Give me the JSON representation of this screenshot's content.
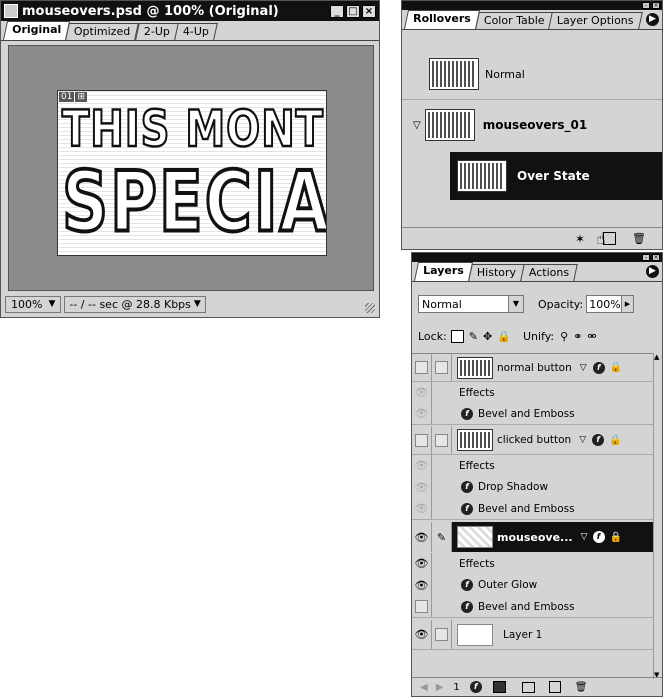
{
  "doc_window": {
    "title": "mouseovers.psd @ 100% (Original)",
    "tabs": [
      "Original",
      "Optimized",
      "2-Up",
      "4-Up"
    ],
    "canvas_text_line1": "THIS MONTH'S",
    "canvas_text_line2": "SPECIAL",
    "slice_badge": "01",
    "zoom": "100%",
    "download_info": "-- / -- sec @ 28.8 Kbps"
  },
  "rollovers_panel": {
    "tabs": [
      "Rollovers",
      "Color Table",
      "Layer Options"
    ],
    "items": [
      {
        "label": "Normal"
      },
      {
        "label": "mouseovers_01"
      },
      {
        "label": "Over State"
      }
    ]
  },
  "layers_panel": {
    "tabs": [
      "Layers",
      "History",
      "Actions"
    ],
    "blend_mode": "Normal",
    "opacity_label": "Opacity:",
    "opacity_value": "100%",
    "lock_label": "Lock:",
    "unify_label": "Unify:",
    "layers": [
      {
        "name": "normal button",
        "effects_label": "Effects",
        "effects": [
          "Bevel and Emboss"
        ]
      },
      {
        "name": "clicked button",
        "effects_label": "Effects",
        "effects": [
          "Drop Shadow",
          "Bevel and Emboss"
        ]
      },
      {
        "name": "mouseove...",
        "effects_label": "Effects",
        "effects": [
          "Outer Glow",
          "Bevel and Emboss"
        ]
      },
      {
        "name": "Layer 1"
      }
    ],
    "footer_number": "1"
  },
  "colors": {
    "panel_bg": "#d4d4d4",
    "selected_bg": "#111111",
    "canvas_gray": "#8c8c8c"
  }
}
